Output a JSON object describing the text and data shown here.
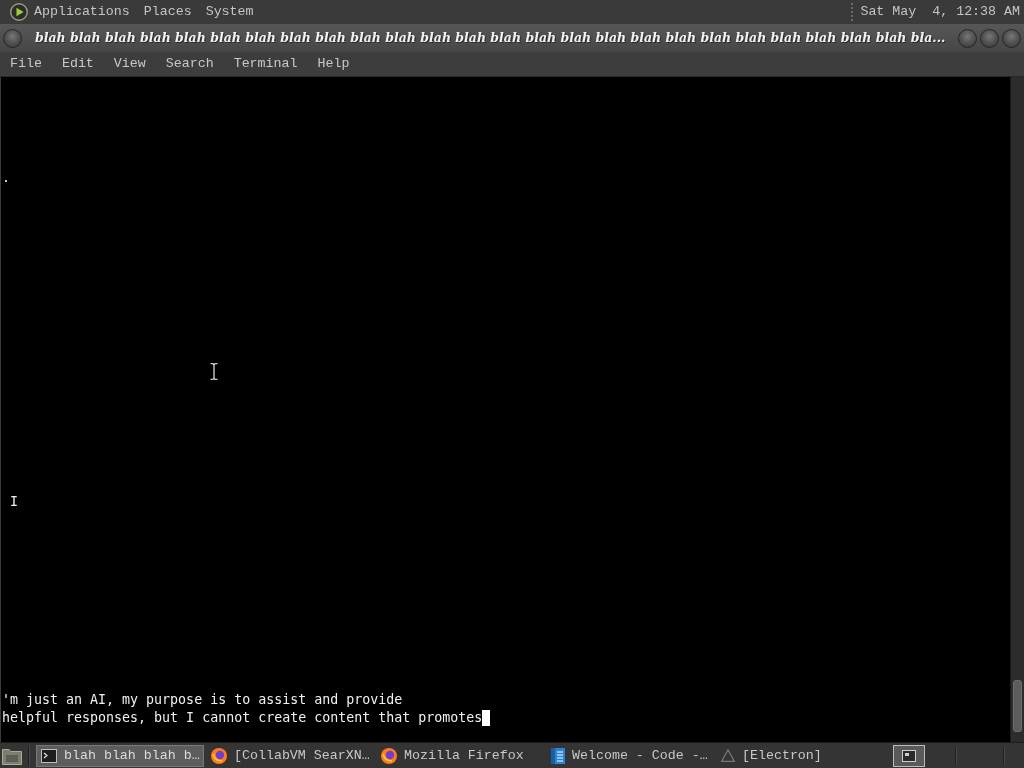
{
  "top_panel": {
    "menus": [
      "Applications",
      "Places",
      "System"
    ],
    "clock": "Sat May  4, 12:38 AM"
  },
  "window": {
    "title": "blah blah blah blah blah blah blah blah blah blah blah blah blah blah blah blah blah blah blah blah blah blah blah blah blah bla..."
  },
  "menu_bar": [
    "File",
    "Edit",
    "View",
    "Search",
    "Terminal",
    "Help"
  ],
  "terminal": {
    "lines": [
      ".",
      "I",
      "'m just an AI, my purpose is to assist and provide",
      "helpful responses, but I cannot create content that promotes"
    ],
    "cursor_visible": true
  },
  "taskbar": {
    "tasks": [
      {
        "label": "blah blah blah b…",
        "kind": "terminal",
        "selected": true
      },
      {
        "label": "[CollabVM SearXN…",
        "kind": "browser",
        "selected": false
      },
      {
        "label": "Mozilla Firefox",
        "kind": "browser",
        "selected": false
      },
      {
        "label": "Welcome - Code -…",
        "kind": "editor",
        "selected": false
      },
      {
        "label": "[Electron]",
        "kind": "app",
        "selected": false
      }
    ]
  }
}
